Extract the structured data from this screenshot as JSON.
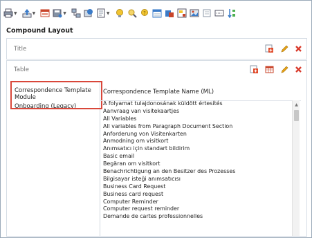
{
  "toolbar": {
    "icons": [
      "print-icon",
      "upload-icon",
      "export-icon",
      "save-as-icon",
      "network-icon",
      "globe-icon",
      "document-dropdown-icon",
      "lightbulb-icon",
      "find-replace-icon",
      "help-icon",
      "calendar-icon",
      "data-icon",
      "template-icon",
      "image-icon",
      "preview-icon",
      "code-icon",
      "sort-icon"
    ]
  },
  "section": {
    "title": "Compound Layout"
  },
  "title_panel": {
    "label": "Title"
  },
  "table_panel": {
    "label": "Table"
  },
  "left_column": {
    "header": "Correspondence Template Module",
    "selected_item": "Onboarding (Legacy)"
  },
  "right_column": {
    "header": "Correspondence Template Name (ML)",
    "items": [
      "A folyamat tulajdonosának küldött értesítés",
      "Aanvraag van visitekaartjes",
      "All Variables",
      "All variables from Paragraph Document Section",
      "Anforderung von Visitenkarten",
      "Anmodning om visitkort",
      "Anımsatıcı için standart bildirim",
      "Basic email",
      "Begäran om visitkort",
      "Benachrichtigung an den Besitzer des Prozesses",
      "Bilgisayar isteği anımsatıcısı",
      "Business Card Request",
      "Business card request",
      "Computer Reminder",
      "Computer request reminder",
      "Demande de cartes professionnelles"
    ]
  },
  "colors": {
    "highlight": "#d9473a",
    "add": "#e04a2a",
    "edit": "#e8a317",
    "delete": "#d93a2b"
  }
}
